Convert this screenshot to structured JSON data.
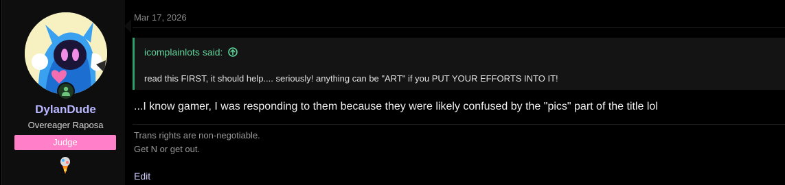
{
  "user": {
    "name": "DylanDude",
    "title": "Overeager Raposa",
    "banner": "Judge",
    "avatar_icon": "raposa-avatar",
    "status_icon": "online-user-icon",
    "trophy_icon": "trophy-icon"
  },
  "post": {
    "date": "Mar 17, 2026",
    "quote": {
      "author_line": "icomplainlots said:",
      "jump_icon": "arrow-up-circle-icon",
      "text": "read this FIRST, it should help.... seriously! anything can be \"ART\" if you PUT YOUR EFFORTS INTO IT!"
    },
    "message": "...I know gamer, I was responding to them because they were likely confused by the \"pics\" part of the title lol",
    "signature": {
      "line1": "Trans rights are non-negotiable.",
      "line2": "Get N or get out."
    },
    "edit_label": "Edit"
  },
  "colors": {
    "background": "#000000",
    "username": "#b9b7ff",
    "banner": "#ff80c9",
    "quote_accent": "#2ca16b",
    "quote_author": "#5fd39a"
  }
}
